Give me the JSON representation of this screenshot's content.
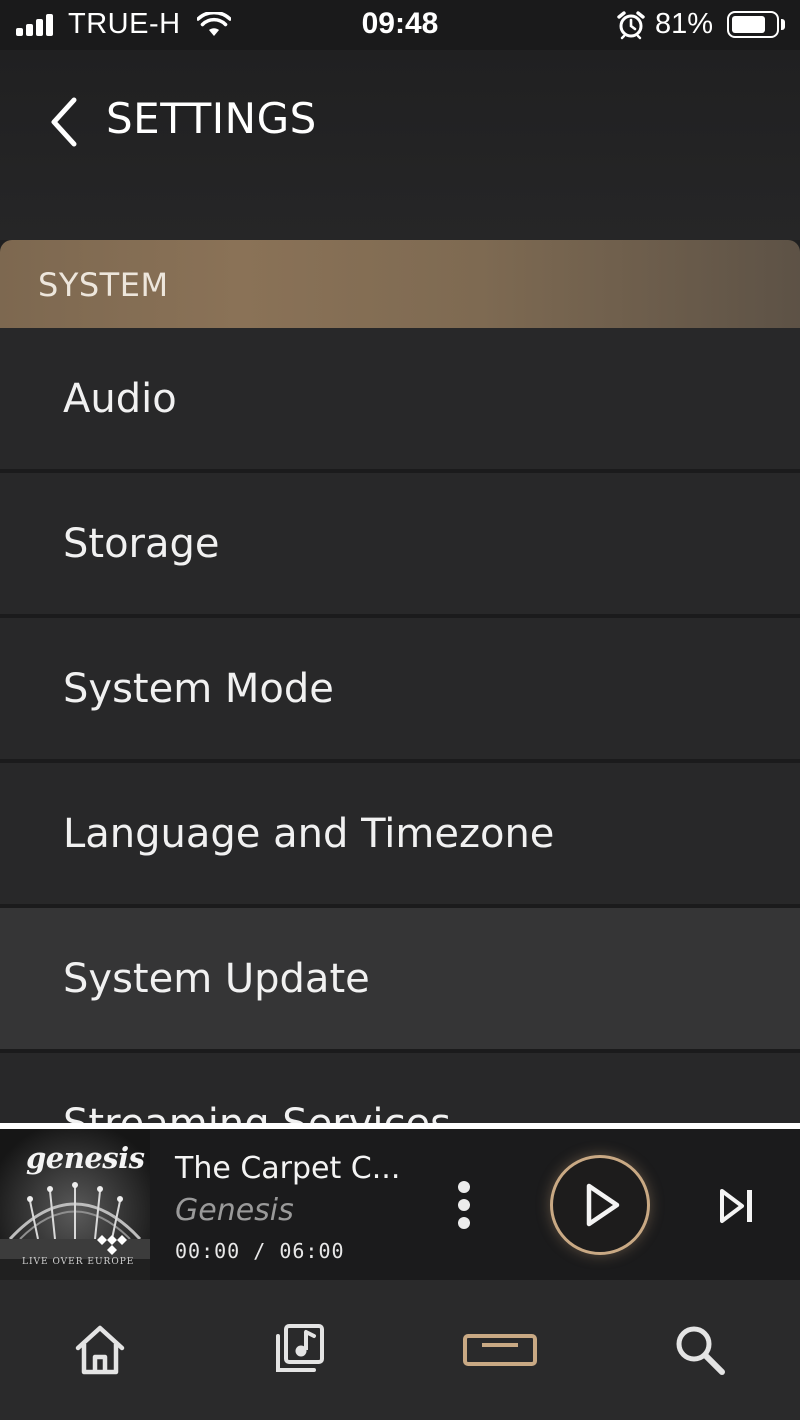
{
  "status_bar": {
    "carrier": "TRUE-H",
    "time": "09:48",
    "battery_percent_text": "81%",
    "battery_level": 0.81,
    "signal_bars": 4,
    "icons": [
      "signal-icon",
      "wifi-icon",
      "alarm-icon",
      "battery-icon"
    ]
  },
  "header": {
    "title": "SETTINGS",
    "back_icon": "chevron-left-icon"
  },
  "section": {
    "label": "SYSTEM"
  },
  "settings": {
    "items": [
      {
        "label": "Audio"
      },
      {
        "label": "Storage"
      },
      {
        "label": "System Mode"
      },
      {
        "label": "Language and Timezone"
      },
      {
        "label": "System Update"
      },
      {
        "label": "Streaming Services"
      }
    ],
    "highlighted_index": 4
  },
  "now_playing": {
    "title": "The Carpet C...",
    "artist": "Genesis",
    "time": "00:00 / 06:00",
    "album_art": {
      "logo_text": "genesis",
      "caption": "LIVE OVER EUROPE"
    },
    "controls": [
      "more-vertical-icon",
      "play-icon",
      "skip-next-icon"
    ]
  },
  "bottom_nav": {
    "items": [
      "home-icon",
      "library-icon",
      "now-playing-icon",
      "search-icon"
    ],
    "active": "now-playing-icon"
  },
  "colors": {
    "background": "#1f1f20",
    "list_item": "#282829",
    "list_item_highlighted": "#353536",
    "section_header": "#8a7257",
    "accent": "#c9a984",
    "text": "#f1f1f1",
    "muted_text": "#9a9a9a"
  }
}
